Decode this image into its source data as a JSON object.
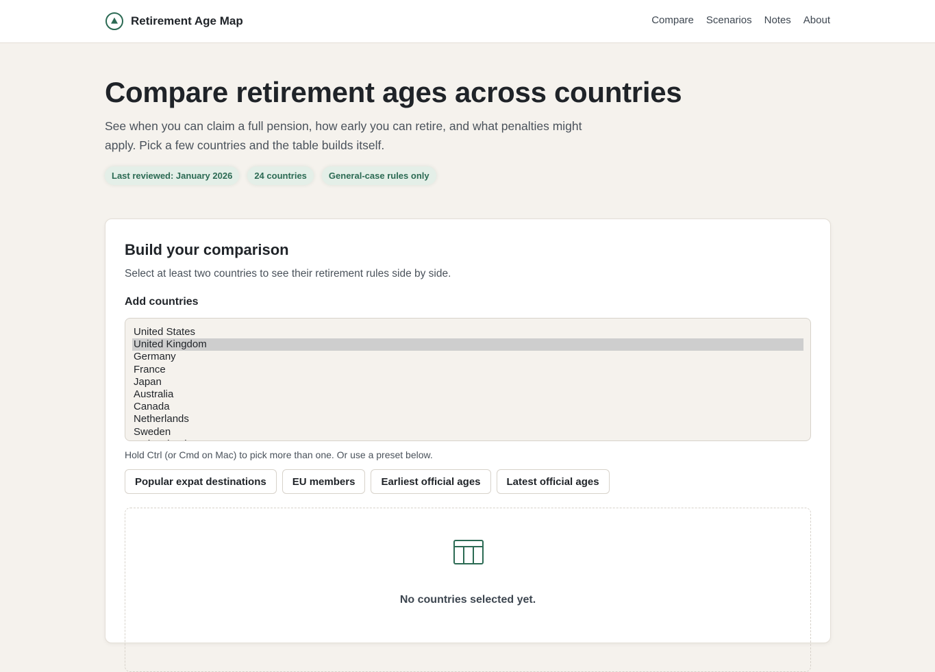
{
  "header": {
    "brand_name": "Retirement Age Map",
    "logo_icon": "triangle-in-circle-icon",
    "nav": [
      {
        "label": "Compare"
      },
      {
        "label": "Scenarios"
      },
      {
        "label": "Notes"
      },
      {
        "label": "About"
      }
    ]
  },
  "hero": {
    "title": "Compare retirement ages across countries",
    "lead": "See when you can claim a full pension, how early you can retire, and what penalties might apply. Pick a few countries and the table builds itself.",
    "pills": [
      {
        "label": "Last reviewed: January 2026"
      },
      {
        "label": "24 countries"
      },
      {
        "label": "General-case rules only"
      }
    ]
  },
  "builder": {
    "title": "Build your comparison",
    "subtitle": "Select at least two countries to see their retirement rules side by side.",
    "countries_label": "Add countries",
    "countries": [
      {
        "name": "United States",
        "selected": false
      },
      {
        "name": "United Kingdom",
        "selected": true
      },
      {
        "name": "Germany",
        "selected": false
      },
      {
        "name": "France",
        "selected": false
      },
      {
        "name": "Japan",
        "selected": false
      },
      {
        "name": "Australia",
        "selected": false
      },
      {
        "name": "Canada",
        "selected": false
      },
      {
        "name": "Netherlands",
        "selected": false
      },
      {
        "name": "Sweden",
        "selected": false
      },
      {
        "name": "Switzerland",
        "selected": false
      }
    ],
    "hint": "Hold Ctrl (or Cmd on Mac) to pick more than one. Or use a preset below.",
    "presets": [
      {
        "label": "Popular expat destinations"
      },
      {
        "label": "EU members"
      },
      {
        "label": "Earliest official ages"
      },
      {
        "label": "Latest official ages"
      }
    ],
    "empty_state": {
      "icon": "table-icon",
      "text": "No countries selected yet."
    }
  },
  "colors": {
    "accent": "#2b6a53",
    "page_background": "#f5f2ed",
    "pill_background": "#e4efe8"
  }
}
